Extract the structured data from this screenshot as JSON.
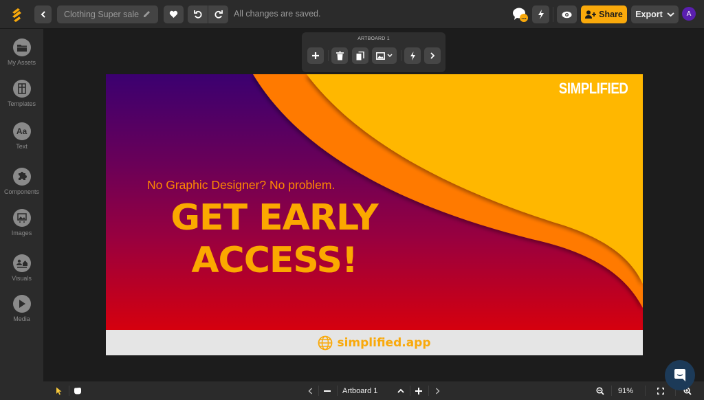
{
  "topbar": {
    "document_title": "Clothing Super sale",
    "save_status": "All changes are saved.",
    "share_label": "Share",
    "export_label": "Export",
    "avatar_initial": "A",
    "accent_color": "#f9a90b"
  },
  "sidebar": {
    "items": [
      {
        "label": "My Assets",
        "icon": "folder-icon"
      },
      {
        "label": "Templates",
        "icon": "templates-icon"
      },
      {
        "label": "Text",
        "icon": "text-icon",
        "glyph": "Aa"
      },
      {
        "label": "Components",
        "icon": "puzzle-icon"
      },
      {
        "label": "Images",
        "icon": "image-icon"
      },
      {
        "label": "Visuals",
        "icon": "visuals-icon"
      },
      {
        "label": "Media",
        "icon": "play-icon"
      }
    ]
  },
  "artboard_toolbar": {
    "label": "ARTBOARD 1"
  },
  "artboard": {
    "brand": "SIMPLIFIED",
    "tagline": "No Graphic Designer? No problem.",
    "headline_line1": "GET EARLY",
    "headline_line2": "ACCESS!",
    "footer_url": "simplified.app",
    "colors": {
      "gradient_top": "#3b0070",
      "gradient_bottom": "#d5000e",
      "orange_wave": "#ff7a00",
      "yellow_wave": "#ffb700",
      "text_yellow": "#fba800",
      "footer_bg": "#e5e5e5"
    }
  },
  "bottombar": {
    "artboard_name": "Artboard 1",
    "zoom_level": "91%"
  }
}
